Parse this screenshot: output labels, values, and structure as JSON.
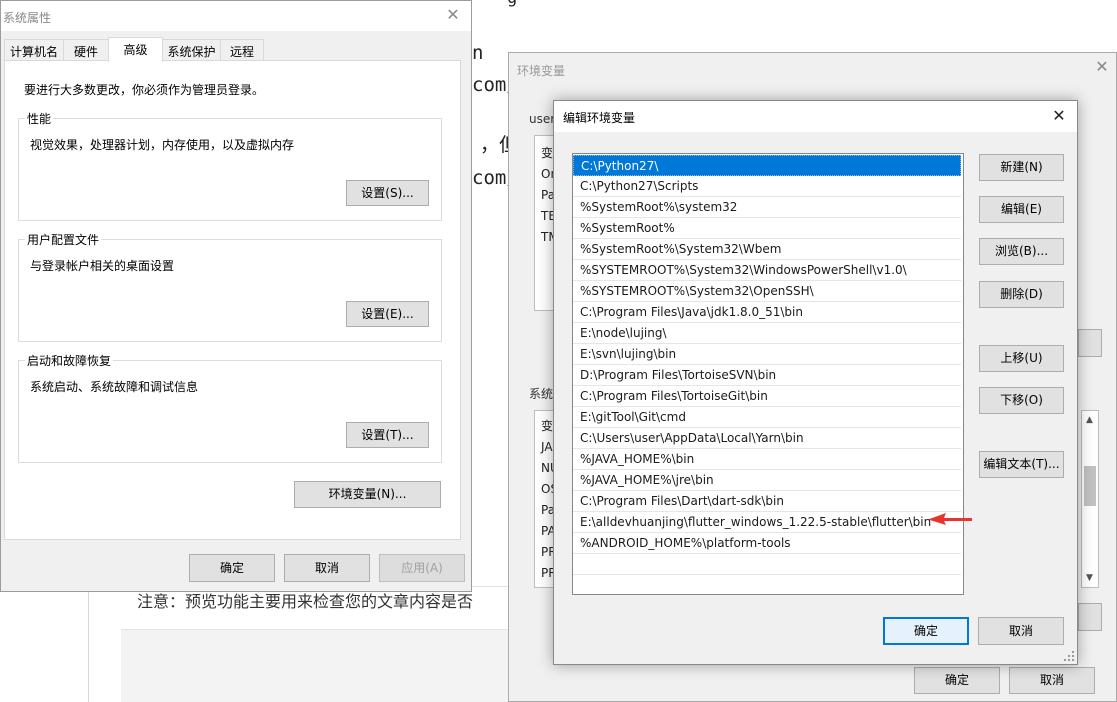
{
  "background": {
    "lines": [
      "n",
      "com/",
      "，但",
      "com/"
    ],
    "stray_top": "g",
    "note": "注意：预览功能主要用来检查您的文章内容是否"
  },
  "system_properties": {
    "title": "系统属性",
    "tabs": [
      "计算机名",
      "硬件",
      "高级",
      "系统保护",
      "远程"
    ],
    "active_tab": "高级",
    "admin_note": "要进行大多数更改，你必须作为管理员登录。",
    "groups": [
      {
        "label": "性能",
        "desc": "视觉效果，处理器计划，内存使用，以及虚拟内存",
        "button": "设置(S)..."
      },
      {
        "label": "用户配置文件",
        "desc": "与登录帐户相关的桌面设置",
        "button": "设置(E)..."
      },
      {
        "label": "启动和故障恢复",
        "desc": "系统启动、系统故障和调试信息",
        "button": "设置(T)..."
      }
    ],
    "env_button": "环境变量(N)...",
    "ok": "确定",
    "cancel": "取消",
    "apply": "应用(A)"
  },
  "env_vars": {
    "title": "环境变量",
    "user_section_label": "user",
    "user_rows": [
      "变",
      "On",
      "Pa",
      "TE",
      "TM"
    ],
    "system_section_label": "系统",
    "system_rows": [
      "变",
      "JA",
      "NU",
      "OS",
      "Pa",
      "PA",
      "PR",
      "PR"
    ],
    "ok": "确定",
    "cancel": "取消"
  },
  "edit_env": {
    "title": "编辑环境变量",
    "selected_index": 0,
    "paths": [
      "C:\\Python27\\",
      "C:\\Python27\\Scripts",
      "%SystemRoot%\\system32",
      "%SystemRoot%",
      "%SystemRoot%\\System32\\Wbem",
      "%SYSTEMROOT%\\System32\\WindowsPowerShell\\v1.0\\",
      "%SYSTEMROOT%\\System32\\OpenSSH\\",
      "C:\\Program Files\\Java\\jdk1.8.0_51\\bin",
      "E:\\node\\lujing\\",
      "E:\\svn\\lujing\\bin",
      "D:\\Program Files\\TortoiseSVN\\bin",
      "C:\\Program Files\\TortoiseGit\\bin",
      "E:\\gitTool\\Git\\cmd",
      "C:\\Users\\user\\AppData\\Local\\Yarn\\bin",
      "%JAVA_HOME%\\bin",
      "%JAVA_HOME%\\jre\\bin",
      "C:\\Program Files\\Dart\\dart-sdk\\bin",
      "E:\\alldevhuanjing\\flutter_windows_1.22.5-stable\\flutter\\bin",
      "%ANDROID_HOME%\\platform-tools"
    ],
    "highlighted_path_index": 17,
    "buttons": {
      "new": "新建(N)",
      "edit": "编辑(E)",
      "browse": "浏览(B)...",
      "delete": "删除(D)",
      "move_up": "上移(U)",
      "move_down": "下移(O)",
      "edit_text": "编辑文本(T)..."
    },
    "ok": "确定",
    "cancel": "取消",
    "arrow_color": "#e8342c"
  }
}
